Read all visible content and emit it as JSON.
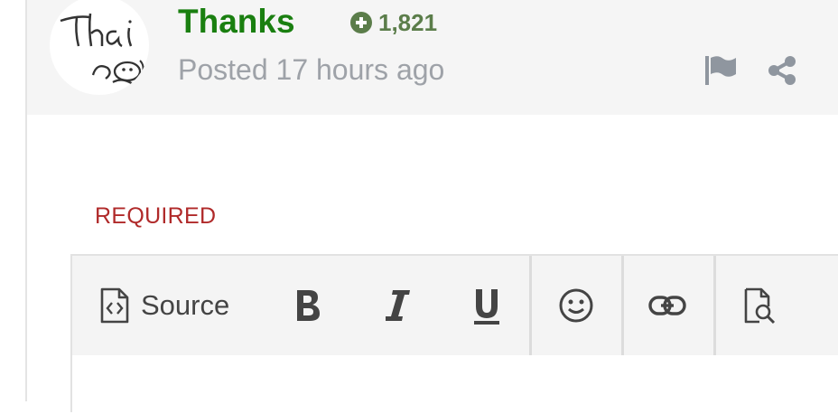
{
  "post": {
    "author": "Thanks",
    "reputation": "1,821",
    "posted": "Posted 17 hours ago",
    "avatar_text": "Thai"
  },
  "reply": {
    "required_label": "REQUIRED"
  },
  "toolbar": {
    "source_label": "Source",
    "items": [
      "source-icon",
      "bold-icon",
      "italic-icon",
      "underline-icon",
      "smiley-icon",
      "link-icon",
      "preview-icon"
    ]
  },
  "colors": {
    "author": "#1a7f10",
    "reputation": "#5b7d4a",
    "muted": "#9ea2a8",
    "required": "#b02a2a",
    "header_bg": "#f5f5f5"
  }
}
